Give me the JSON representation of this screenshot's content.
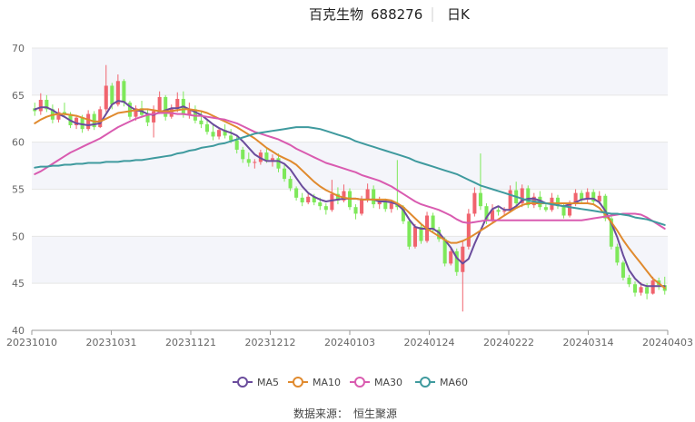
{
  "chart_data": {
    "type": "candlestick",
    "title": {
      "name": "百克生物",
      "code": "688276",
      "period": "日K"
    },
    "ylim": [
      40,
      70
    ],
    "yticks": [
      40,
      45,
      50,
      55,
      60,
      65,
      70
    ],
    "x_tick_labels": [
      "20231010",
      "20231031",
      "20231121",
      "20231212",
      "20240103",
      "20240124",
      "20240222",
      "20240314",
      "20240403"
    ],
    "colors": {
      "up": "#f0646e",
      "down": "#7ee85a"
    },
    "ohlc": [
      [
        63.6,
        64.2,
        62.8,
        63.3
      ],
      [
        63.3,
        65.2,
        62.9,
        64.5
      ],
      [
        64.5,
        65.0,
        63.2,
        63.5
      ],
      [
        63.5,
        64.0,
        62.0,
        62.4
      ],
      [
        62.4,
        63.6,
        62.1,
        63.2
      ],
      [
        63.2,
        64.2,
        62.6,
        63.0
      ],
      [
        63.0,
        63.2,
        61.5,
        61.8
      ],
      [
        61.8,
        62.9,
        61.4,
        62.6
      ],
      [
        62.6,
        62.9,
        61.0,
        61.4
      ],
      [
        61.4,
        63.4,
        61.2,
        63.0
      ],
      [
        63.0,
        63.3,
        61.3,
        61.6
      ],
      [
        61.6,
        63.8,
        61.5,
        63.5
      ],
      [
        63.5,
        68.2,
        63.2,
        66.0
      ],
      [
        66.0,
        66.3,
        63.5,
        64.0
      ],
      [
        64.0,
        67.2,
        63.8,
        66.5
      ],
      [
        66.5,
        66.7,
        63.8,
        64.2
      ],
      [
        64.2,
        64.4,
        62.4,
        62.7
      ],
      [
        62.7,
        63.9,
        62.3,
        63.6
      ],
      [
        63.6,
        64.4,
        62.6,
        62.9
      ],
      [
        62.9,
        63.5,
        61.7,
        62.1
      ],
      [
        62.1,
        63.9,
        60.5,
        63.3
      ],
      [
        63.3,
        65.4,
        63.0,
        64.8
      ],
      [
        64.8,
        65.0,
        62.3,
        62.7
      ],
      [
        62.7,
        64.0,
        62.5,
        63.6
      ],
      [
        63.6,
        65.3,
        63.2,
        64.6
      ],
      [
        64.6,
        65.4,
        62.6,
        62.9
      ],
      [
        62.9,
        64.2,
        62.5,
        63.5
      ],
      [
        63.5,
        63.9,
        62.0,
        62.3
      ],
      [
        62.3,
        63.2,
        61.5,
        61.9
      ],
      [
        61.9,
        62.5,
        60.8,
        61.1
      ],
      [
        61.1,
        61.9,
        60.2,
        60.6
      ],
      [
        60.6,
        61.6,
        60.3,
        61.3
      ],
      [
        61.3,
        61.9,
        60.4,
        60.7
      ],
      [
        60.7,
        61.4,
        59.9,
        60.2
      ],
      [
        60.2,
        60.6,
        58.8,
        59.2
      ],
      [
        59.2,
        59.5,
        57.8,
        58.2
      ],
      [
        58.2,
        58.9,
        57.4,
        57.8
      ],
      [
        57.8,
        58.2,
        57.2,
        57.9
      ],
      [
        57.9,
        59.2,
        57.6,
        58.9
      ],
      [
        58.9,
        59.4,
        57.8,
        58.1
      ],
      [
        58.1,
        58.7,
        57.4,
        58.3
      ],
      [
        58.3,
        58.8,
        56.8,
        57.2
      ],
      [
        57.2,
        57.6,
        55.8,
        56.1
      ],
      [
        56.1,
        56.4,
        54.8,
        55.1
      ],
      [
        55.1,
        55.3,
        53.8,
        54.1
      ],
      [
        54.1,
        54.6,
        53.2,
        53.6
      ],
      [
        53.6,
        54.5,
        53.4,
        54.2
      ],
      [
        54.2,
        54.5,
        53.3,
        53.6
      ],
      [
        53.6,
        54.1,
        52.8,
        53.2
      ],
      [
        53.2,
        53.5,
        52.3,
        52.8
      ],
      [
        52.8,
        56.0,
        52.6,
        54.5
      ],
      [
        54.5,
        55.2,
        53.4,
        53.8
      ],
      [
        53.8,
        55.5,
        53.6,
        54.8
      ],
      [
        54.8,
        55.1,
        52.8,
        53.1
      ],
      [
        53.1,
        53.4,
        51.8,
        52.4
      ],
      [
        52.4,
        54.3,
        52.2,
        53.9
      ],
      [
        53.9,
        55.6,
        53.6,
        55.0
      ],
      [
        55.0,
        55.4,
        53.0,
        53.4
      ],
      [
        53.4,
        54.2,
        52.9,
        53.8
      ],
      [
        53.8,
        54.0,
        52.6,
        52.9
      ],
      [
        52.9,
        53.8,
        52.5,
        53.5
      ],
      [
        53.5,
        58.1,
        52.8,
        53.1
      ],
      [
        53.1,
        53.3,
        51.3,
        51.6
      ],
      [
        51.6,
        51.8,
        48.6,
        48.9
      ],
      [
        48.9,
        51.3,
        48.7,
        51.0
      ],
      [
        51.0,
        51.4,
        49.2,
        49.5
      ],
      [
        49.5,
        52.6,
        49.3,
        52.2
      ],
      [
        52.2,
        52.5,
        50.4,
        50.7
      ],
      [
        50.7,
        51.0,
        49.4,
        49.7
      ],
      [
        49.7,
        49.9,
        46.8,
        47.1
      ],
      [
        47.1,
        48.8,
        46.9,
        48.4
      ],
      [
        48.4,
        48.7,
        45.8,
        46.2
      ],
      [
        46.2,
        49.6,
        42.0,
        48.9
      ],
      [
        48.9,
        52.9,
        48.6,
        52.4
      ],
      [
        52.4,
        55.2,
        52.1,
        54.6
      ],
      [
        54.6,
        58.8,
        52.8,
        53.2
      ],
      [
        53.2,
        53.5,
        51.3,
        51.7
      ],
      [
        51.7,
        53.4,
        51.4,
        52.8
      ],
      [
        52.8,
        53.2,
        52.2,
        52.6
      ],
      [
        52.6,
        53.1,
        52.3,
        52.7
      ],
      [
        52.7,
        55.4,
        52.5,
        54.9
      ],
      [
        54.9,
        55.8,
        53.1,
        53.5
      ],
      [
        53.5,
        55.5,
        53.1,
        55.1
      ],
      [
        55.1,
        55.4,
        53.0,
        53.3
      ],
      [
        53.3,
        54.6,
        53.0,
        54.2
      ],
      [
        54.2,
        54.8,
        52.8,
        53.1
      ],
      [
        53.1,
        53.4,
        52.6,
        52.8
      ],
      [
        52.8,
        54.6,
        52.6,
        54.1
      ],
      [
        54.1,
        54.4,
        52.9,
        53.2
      ],
      [
        53.2,
        53.4,
        51.9,
        52.2
      ],
      [
        52.2,
        53.8,
        52.0,
        53.4
      ],
      [
        53.4,
        55.0,
        53.2,
        54.6
      ],
      [
        54.6,
        54.9,
        53.5,
        53.9
      ],
      [
        53.9,
        55.1,
        53.6,
        54.7
      ],
      [
        54.7,
        55.0,
        53.4,
        53.7
      ],
      [
        53.7,
        54.8,
        53.4,
        54.3
      ],
      [
        54.3,
        54.5,
        51.6,
        51.9
      ],
      [
        51.9,
        52.2,
        48.6,
        48.9
      ],
      [
        48.9,
        49.2,
        46.9,
        47.2
      ],
      [
        47.2,
        47.4,
        45.3,
        45.6
      ],
      [
        45.6,
        45.9,
        44.6,
        44.9
      ],
      [
        44.9,
        45.2,
        43.6,
        44.0
      ],
      [
        44.0,
        45.1,
        43.7,
        44.6
      ],
      [
        44.6,
        45.0,
        43.3,
        43.9
      ],
      [
        43.9,
        45.7,
        43.8,
        45.3
      ],
      [
        45.3,
        45.6,
        44.3,
        44.8
      ],
      [
        44.8,
        45.7,
        43.8,
        44.2
      ]
    ],
    "series": [
      {
        "name": "MA5",
        "color": "#6a4c9c",
        "values": [
          63.5,
          63.7,
          63.7,
          63.4,
          63.0,
          62.7,
          62.3,
          62.0,
          61.9,
          61.8,
          61.9,
          62.0,
          63.0,
          64.0,
          64.4,
          64.3,
          63.8,
          63.4,
          63.3,
          63.0,
          62.9,
          63.2,
          63.4,
          63.6,
          63.6,
          63.8,
          63.5,
          63.2,
          62.9,
          62.4,
          61.9,
          61.5,
          61.2,
          61.0,
          60.7,
          60.1,
          59.4,
          58.7,
          58.3,
          58.0,
          58.0,
          58.0,
          57.7,
          57.1,
          56.2,
          55.3,
          54.6,
          54.2,
          53.9,
          53.7,
          53.8,
          53.9,
          54.0,
          54.0,
          54.0,
          53.9,
          53.9,
          53.9,
          53.7,
          53.7,
          53.6,
          53.4,
          52.8,
          51.8,
          51.0,
          50.8,
          50.8,
          50.8,
          50.4,
          49.6,
          48.8,
          47.7,
          47.1,
          47.6,
          49.2,
          50.6,
          52.0,
          52.9,
          53.2,
          52.8,
          52.8,
          53.2,
          53.8,
          54.0,
          54.0,
          53.8,
          53.5,
          53.5,
          53.3,
          53.2,
          53.4,
          53.6,
          53.9,
          54.0,
          54.0,
          53.6,
          52.7,
          51.4,
          49.9,
          48.0,
          46.4,
          45.5,
          44.9,
          44.7,
          44.7,
          44.7,
          44.7
        ]
      },
      {
        "name": "MA10",
        "color": "#e08a2e",
        "values": [
          62.0,
          62.4,
          62.7,
          62.9,
          63.0,
          63.0,
          62.9,
          62.8,
          62.6,
          62.4,
          62.2,
          62.2,
          62.5,
          62.8,
          63.1,
          63.2,
          63.3,
          63.4,
          63.5,
          63.5,
          63.4,
          63.3,
          63.3,
          63.3,
          63.4,
          63.5,
          63.5,
          63.4,
          63.3,
          63.1,
          62.8,
          62.5,
          62.2,
          61.9,
          61.6,
          61.2,
          60.8,
          60.4,
          59.9,
          59.4,
          59.0,
          58.6,
          58.3,
          58.0,
          57.6,
          57.0,
          56.4,
          55.8,
          55.3,
          54.9,
          54.6,
          54.3,
          54.1,
          54.0,
          54.0,
          53.9,
          53.9,
          53.9,
          53.9,
          53.9,
          53.8,
          53.5,
          53.1,
          52.5,
          51.9,
          51.3,
          50.8,
          50.4,
          50.0,
          49.6,
          49.3,
          49.3,
          49.5,
          49.8,
          50.2,
          50.6,
          51.0,
          51.4,
          51.8,
          52.2,
          52.6,
          53.0,
          53.3,
          53.5,
          53.5,
          53.5,
          53.5,
          53.5,
          53.5,
          53.5,
          53.5,
          53.5,
          53.5,
          53.5,
          53.4,
          53.0,
          52.3,
          51.5,
          50.6,
          49.6,
          48.7,
          47.9,
          47.1,
          46.3,
          45.5,
          45.0,
          44.5
        ]
      },
      {
        "name": "MA30",
        "color": "#d95bb0",
        "values": [
          56.6,
          56.9,
          57.3,
          57.7,
          58.1,
          58.5,
          58.9,
          59.2,
          59.5,
          59.8,
          60.1,
          60.4,
          60.8,
          61.2,
          61.6,
          61.9,
          62.2,
          62.5,
          62.7,
          62.9,
          63.0,
          63.1,
          63.1,
          63.1,
          63.0,
          63.0,
          62.9,
          62.8,
          62.8,
          62.7,
          62.6,
          62.5,
          62.4,
          62.2,
          62.0,
          61.7,
          61.4,
          61.1,
          60.9,
          60.7,
          60.5,
          60.3,
          60.0,
          59.7,
          59.3,
          59.0,
          58.7,
          58.4,
          58.1,
          57.8,
          57.6,
          57.4,
          57.2,
          57.0,
          56.8,
          56.5,
          56.3,
          56.1,
          55.9,
          55.6,
          55.3,
          54.9,
          54.5,
          54.1,
          53.7,
          53.4,
          53.2,
          53.0,
          52.8,
          52.5,
          52.2,
          51.8,
          51.5,
          51.4,
          51.5,
          51.6,
          51.7,
          51.7,
          51.7,
          51.7,
          51.7,
          51.7,
          51.7,
          51.7,
          51.7,
          51.7,
          51.7,
          51.7,
          51.7,
          51.7,
          51.7,
          51.7,
          51.7,
          51.8,
          51.9,
          52.0,
          52.1,
          52.2,
          52.3,
          52.4,
          52.4,
          52.4,
          52.3,
          52.0,
          51.6,
          51.2,
          50.8
        ]
      },
      {
        "name": "MA60",
        "color": "#3f9a9e",
        "values": [
          57.3,
          57.4,
          57.4,
          57.5,
          57.5,
          57.6,
          57.6,
          57.7,
          57.7,
          57.8,
          57.8,
          57.8,
          57.9,
          57.9,
          57.9,
          58.0,
          58.0,
          58.1,
          58.1,
          58.2,
          58.3,
          58.4,
          58.5,
          58.6,
          58.8,
          58.9,
          59.1,
          59.2,
          59.4,
          59.5,
          59.6,
          59.8,
          59.9,
          60.1,
          60.3,
          60.5,
          60.7,
          60.9,
          61.0,
          61.1,
          61.2,
          61.3,
          61.4,
          61.5,
          61.6,
          61.6,
          61.6,
          61.5,
          61.4,
          61.2,
          61.0,
          60.8,
          60.6,
          60.4,
          60.1,
          59.9,
          59.7,
          59.5,
          59.3,
          59.1,
          58.9,
          58.7,
          58.5,
          58.3,
          58.0,
          57.8,
          57.6,
          57.4,
          57.2,
          57.0,
          56.8,
          56.6,
          56.3,
          56.0,
          55.7,
          55.4,
          55.2,
          55.0,
          54.8,
          54.6,
          54.4,
          54.2,
          54.0,
          53.8,
          53.7,
          53.6,
          53.5,
          53.4,
          53.3,
          53.2,
          53.1,
          53.0,
          52.9,
          52.8,
          52.7,
          52.6,
          52.5,
          52.4,
          52.4,
          52.3,
          52.2,
          52.0,
          51.9,
          51.8,
          51.6,
          51.4,
          51.2
        ]
      }
    ],
    "source": {
      "label": "数据来源：",
      "value": "恒生聚源"
    }
  }
}
